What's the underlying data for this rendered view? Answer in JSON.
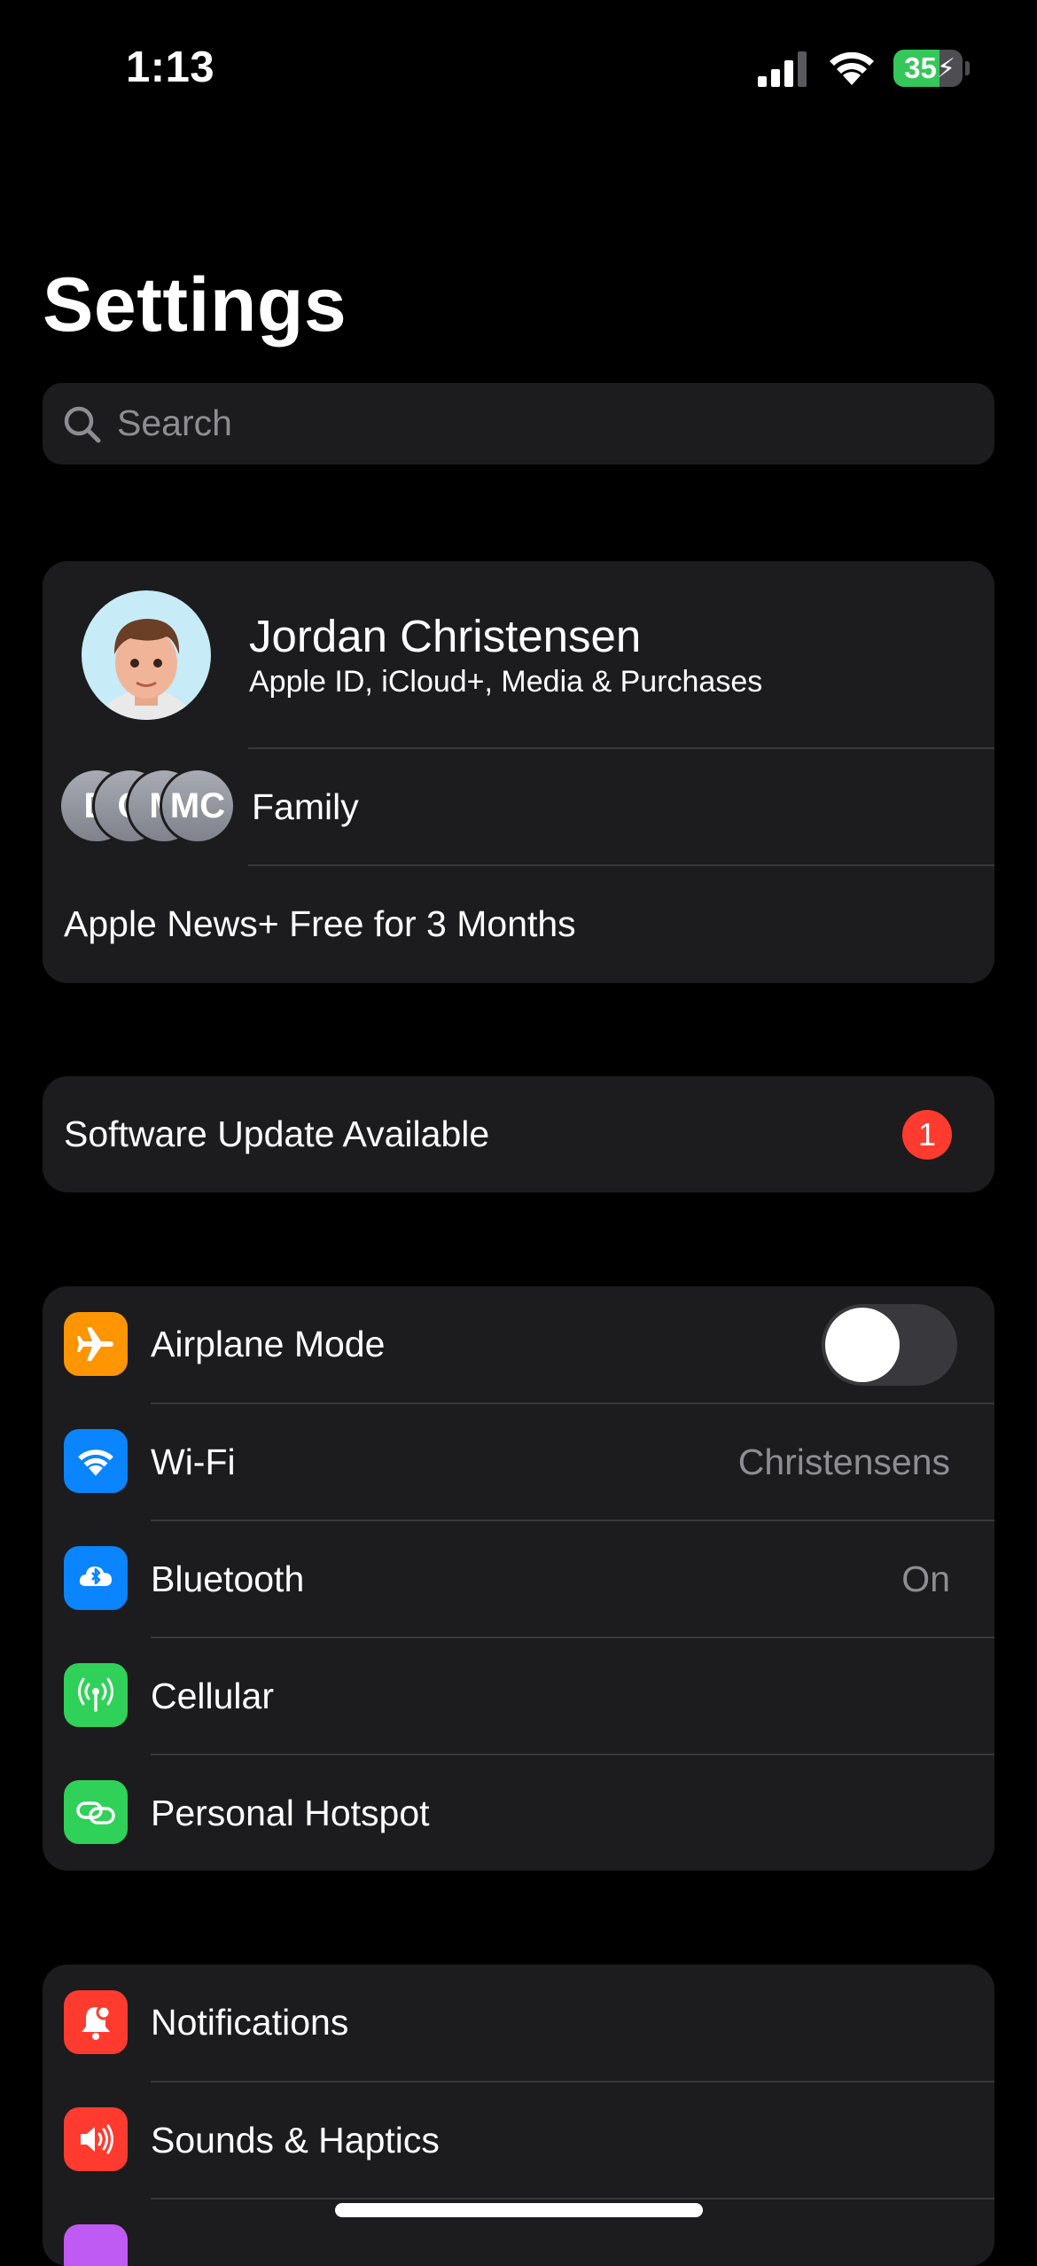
{
  "status_bar": {
    "time": "1:13",
    "battery_percent": "35"
  },
  "header": {
    "title": "Settings"
  },
  "search": {
    "placeholder": "Search"
  },
  "profile": {
    "name": "Jordan Christensen",
    "subtitle": "Apple ID, iCloud+, Media & Purchases",
    "family_initials": [
      "D",
      "C",
      "M",
      "MC"
    ],
    "family_label": "Family",
    "offer": "Apple News+ Free for 3 Months"
  },
  "software_update": {
    "label": "Software Update Available",
    "badge": "1"
  },
  "connectivity": [
    {
      "label": "Airplane Mode",
      "icon": "airplane-icon",
      "color": "#ff9500",
      "toggle": false
    },
    {
      "label": "Wi-Fi",
      "icon": "wifi-icon",
      "color": "#0a84ff",
      "value": "Christensens"
    },
    {
      "label": "Bluetooth",
      "icon": "bluetooth-icon",
      "color": "#0a84ff",
      "value": "On"
    },
    {
      "label": "Cellular",
      "icon": "antenna-icon",
      "color": "#30d158"
    },
    {
      "label": "Personal Hotspot",
      "icon": "link-icon",
      "color": "#30d158"
    }
  ],
  "notifications_group": [
    {
      "label": "Notifications",
      "icon": "bell-icon",
      "color": "#ff3b30"
    },
    {
      "label": "Sounds & Haptics",
      "icon": "speaker-icon",
      "color": "#ff3b30"
    },
    {
      "label": "",
      "icon": "focus-icon",
      "color": "#bf5af2"
    }
  ]
}
